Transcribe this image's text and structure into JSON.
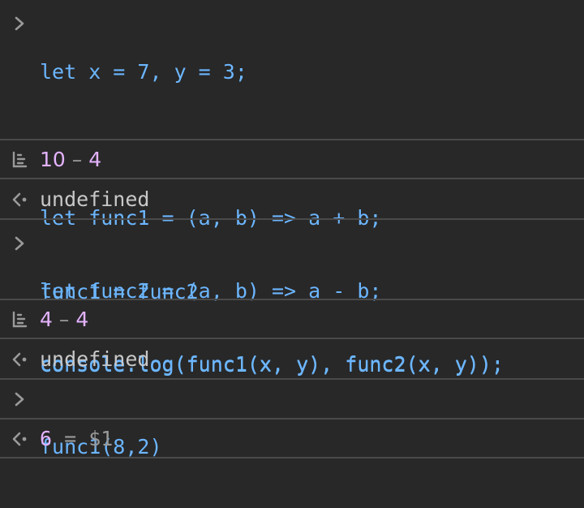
{
  "console": {
    "entries": [
      {
        "type": "input",
        "lines": [
          "let x = 7, y = 3;",
          "",
          "let func1 = (a, b) => a + b;",
          "let func2 = (a, b) => a - b;",
          "console.log(func1(x, y), func2(x, y));"
        ]
      },
      {
        "type": "log",
        "value_a": "10",
        "separator": "–",
        "value_b": "4"
      },
      {
        "type": "result",
        "text": "undefined"
      },
      {
        "type": "input",
        "lines": [
          "func1 = func2",
          "console.log(func1(x, y), func2(x, y));"
        ]
      },
      {
        "type": "log",
        "value_a": "4",
        "separator": "–",
        "value_b": "4"
      },
      {
        "type": "result",
        "text": "undefined"
      },
      {
        "type": "input",
        "lines": [
          "func1(8,2)"
        ]
      },
      {
        "type": "result",
        "value": "6",
        "equals": "=",
        "ref": "$1"
      }
    ]
  },
  "icons": {
    "prompt": "chevron-right-icon",
    "log": "log-output-icon",
    "result": "result-arrow-icon"
  },
  "colors": {
    "background": "#282828",
    "divider": "#4a4a4a",
    "code": "#6cb6ff",
    "number": "#e4b3ff",
    "text": "#c8c8c8",
    "muted": "#9a9a9a"
  }
}
